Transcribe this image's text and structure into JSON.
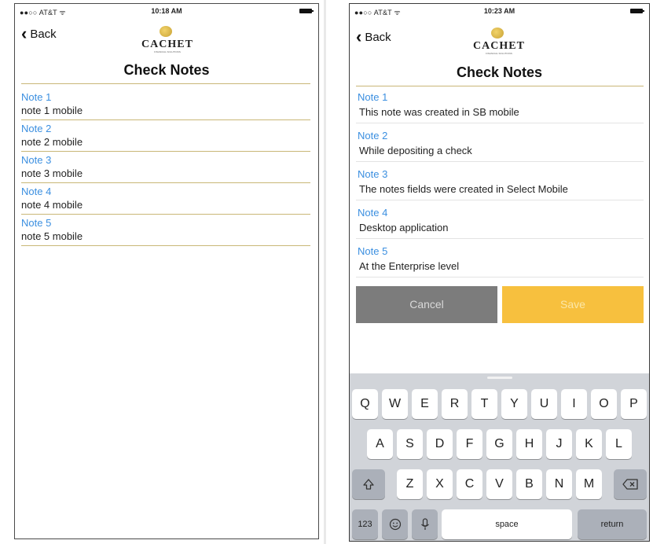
{
  "left": {
    "status": {
      "carrier": "●●○○ AT&T ᯤ",
      "time": "10:18 AM"
    },
    "nav": {
      "back_label": "Back"
    },
    "logo": {
      "word": "CACHET",
      "sub": "FINANCIAL SOLUTIONS"
    },
    "title": "Check Notes",
    "notes": [
      {
        "label": "Note 1",
        "value": "note 1 mobile"
      },
      {
        "label": "Note 2",
        "value": "note 2 mobile"
      },
      {
        "label": "Note 3",
        "value": "note 3 mobile"
      },
      {
        "label": "Note 4",
        "value": "note 4 mobile"
      },
      {
        "label": "Note 5",
        "value": "note 5 mobile"
      }
    ]
  },
  "right": {
    "status": {
      "carrier": "●●○○ AT&T ᯤ",
      "time": "10:23 AM"
    },
    "nav": {
      "back_label": "Back"
    },
    "logo": {
      "word": "CACHET",
      "sub": "FINANCIAL SOLUTIONS"
    },
    "title": "Check Notes",
    "notes": [
      {
        "label": "Note 1",
        "value": "This note was created in SB mobile"
      },
      {
        "label": "Note 2",
        "value": "While depositing a check"
      },
      {
        "label": "Note 3",
        "value": "The notes fields were created in Select Mobile"
      },
      {
        "label": "Note 4",
        "value": "Desktop application"
      },
      {
        "label": "Note 5",
        "value": "At the Enterprise level"
      }
    ],
    "buttons": {
      "cancel": "Cancel",
      "save": "Save"
    },
    "keyboard": {
      "row1": [
        "Q",
        "W",
        "E",
        "R",
        "T",
        "Y",
        "U",
        "I",
        "O",
        "P"
      ],
      "row2": [
        "A",
        "S",
        "D",
        "F",
        "G",
        "H",
        "J",
        "K",
        "L"
      ],
      "row3": [
        "Z",
        "X",
        "C",
        "V",
        "B",
        "N",
        "M"
      ],
      "numbers": "123",
      "space": "space",
      "return": "return",
      "icons": [
        "shift-icon",
        "backspace-icon",
        "emoji-icon",
        "microphone-icon"
      ]
    }
  },
  "colors": {
    "note_label": "#3b8fe0",
    "divider": "#c9b777",
    "cancel_bg": "#7c7c7c",
    "save_bg": "#f7c03e",
    "keyboard_bg": "#d1d4d9"
  }
}
